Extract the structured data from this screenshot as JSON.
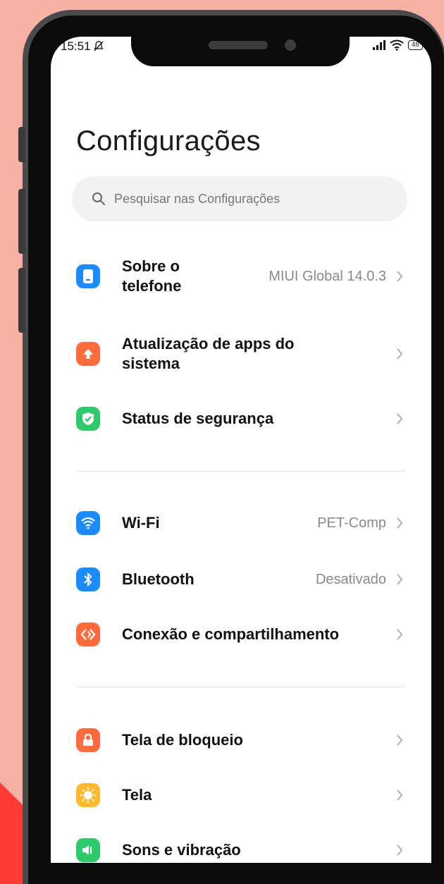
{
  "status": {
    "time": "15:51",
    "battery": "48"
  },
  "page_title": "Configurações",
  "search": {
    "placeholder": "Pesquisar nas Configurações"
  },
  "items": [
    {
      "label": "Sobre o telefone",
      "value": "MIUI Global 14.0.3",
      "icon": "phone-info-icon",
      "color": "#1a8cff"
    },
    {
      "label": "Atualização de apps do sistema",
      "value": "",
      "icon": "update-arrow-icon",
      "color": "#ff6b3d"
    },
    {
      "label": "Status de segurança",
      "value": "",
      "icon": "shield-check-icon",
      "color": "#2ec96b"
    },
    {
      "label": "Wi-Fi",
      "value": "PET-Comp",
      "icon": "wifi-icon",
      "color": "#1a8cff"
    },
    {
      "label": "Bluetooth",
      "value": "Desativado",
      "icon": "bluetooth-icon",
      "color": "#1a8cff"
    },
    {
      "label": "Conexão e compartilhamento",
      "value": "",
      "icon": "connection-share-icon",
      "color": "#ff6b3d"
    },
    {
      "label": "Tela de bloqueio",
      "value": "",
      "icon": "lock-icon",
      "color": "#ff6b3d"
    },
    {
      "label": "Tela",
      "value": "",
      "icon": "sun-icon",
      "color": "#ffb92e"
    },
    {
      "label": "Sons e vibração",
      "value": "",
      "icon": "speaker-icon",
      "color": "#2ec96b"
    }
  ]
}
